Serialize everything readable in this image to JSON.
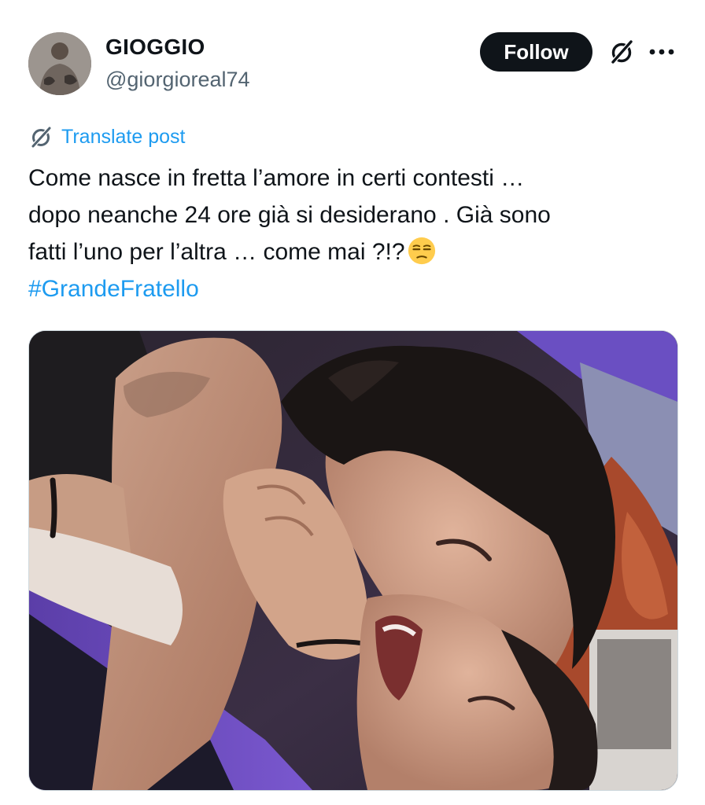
{
  "author": {
    "display_name": "GIOGGIO",
    "handle": "@giorgioreal74"
  },
  "actions": {
    "follow_label": "Follow"
  },
  "post": {
    "translate_label": "Translate post",
    "lines": [
      "Come nasce in fretta l’amore in certi contesti …",
      "dopo neanche 24 ore già si desiderano . Già sono",
      "fatti l’uno per l’altra … come mai ?!?"
    ],
    "hashtag": "#GrandeFratello",
    "emoji": "unamused-face"
  },
  "icons": {
    "grok": "grok-icon",
    "more": "more-icon",
    "translate": "grok-translate-icon"
  },
  "colors": {
    "link": "#1d9bf0",
    "text": "#0f1419",
    "secondary": "#536471",
    "button": "#0f1419"
  }
}
